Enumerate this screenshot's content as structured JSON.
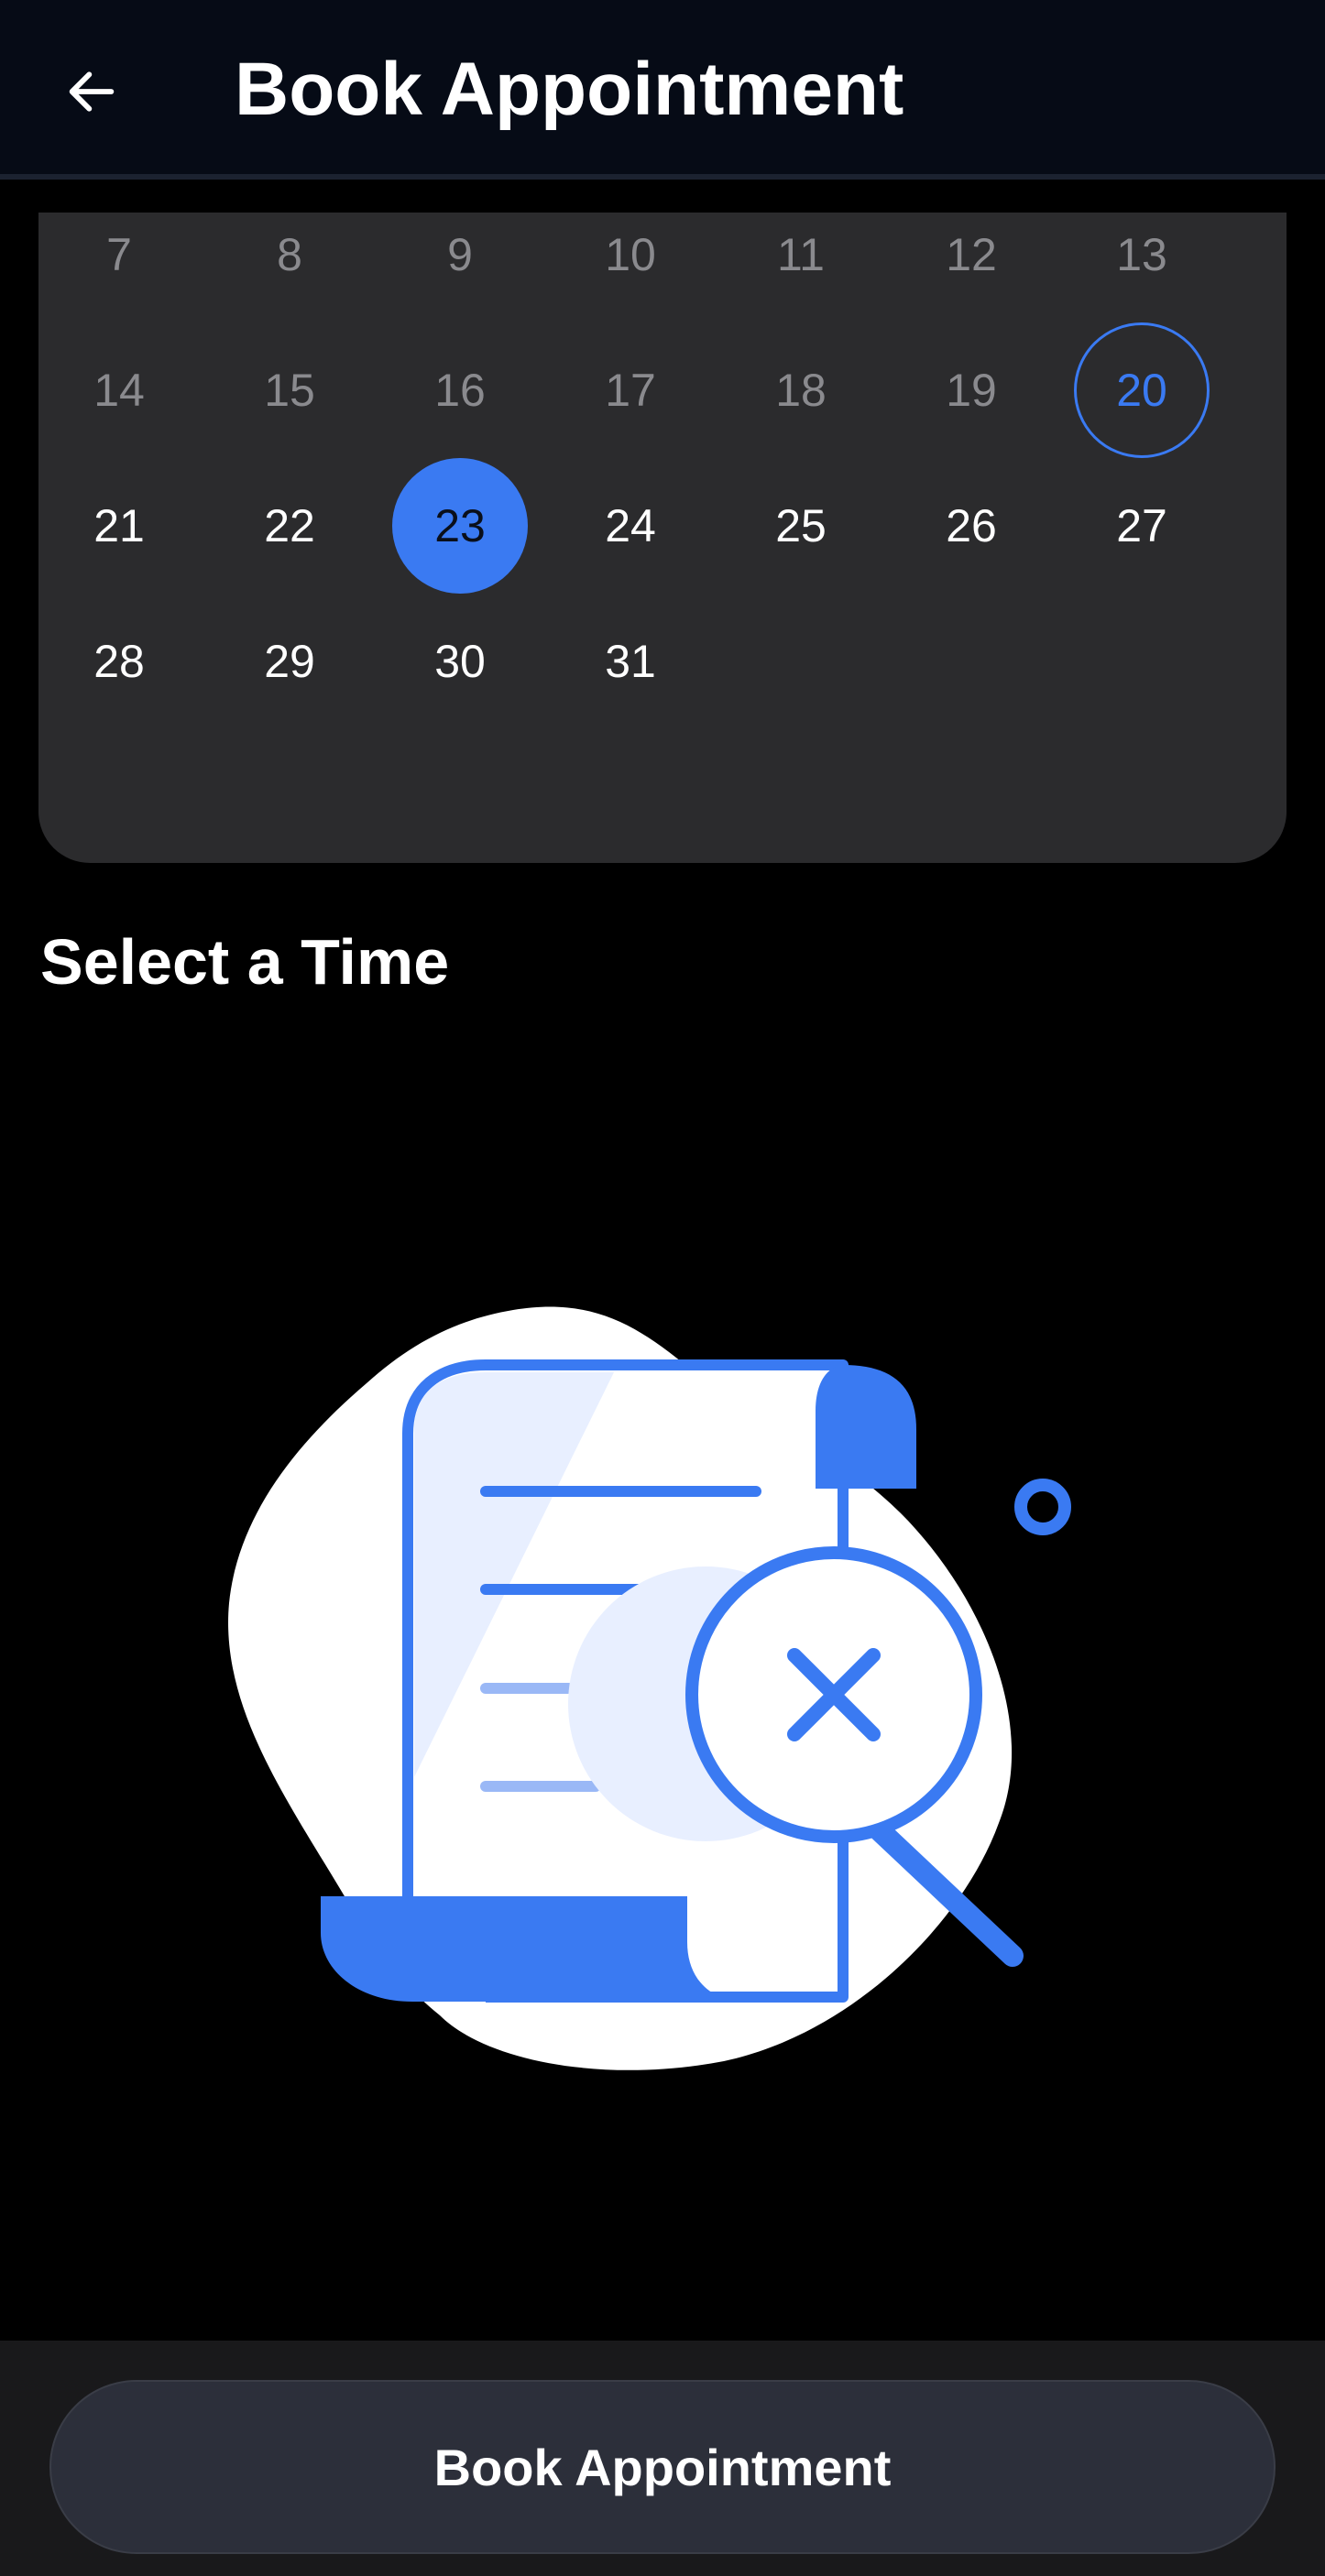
{
  "header": {
    "title": "Book Appointment"
  },
  "calendar": {
    "rows": [
      [
        {
          "day": "7",
          "state": "past"
        },
        {
          "day": "8",
          "state": "past"
        },
        {
          "day": "9",
          "state": "past"
        },
        {
          "day": "10",
          "state": "past"
        },
        {
          "day": "11",
          "state": "past"
        },
        {
          "day": "12",
          "state": "past"
        },
        {
          "day": "13",
          "state": "past"
        }
      ],
      [
        {
          "day": "14",
          "state": "past"
        },
        {
          "day": "15",
          "state": "past"
        },
        {
          "day": "16",
          "state": "past"
        },
        {
          "day": "17",
          "state": "past"
        },
        {
          "day": "18",
          "state": "past"
        },
        {
          "day": "19",
          "state": "past"
        },
        {
          "day": "20",
          "state": "today"
        }
      ],
      [
        {
          "day": "21",
          "state": "available"
        },
        {
          "day": "22",
          "state": "available"
        },
        {
          "day": "23",
          "state": "selected"
        },
        {
          "day": "24",
          "state": "available"
        },
        {
          "day": "25",
          "state": "available"
        },
        {
          "day": "26",
          "state": "available"
        },
        {
          "day": "27",
          "state": "available"
        }
      ],
      [
        {
          "day": "28",
          "state": "available"
        },
        {
          "day": "29",
          "state": "available"
        },
        {
          "day": "30",
          "state": "available"
        },
        {
          "day": "31",
          "state": "available"
        }
      ]
    ]
  },
  "time_section": {
    "title": "Select a Time",
    "empty_state_icon": "document-search-no-results-icon"
  },
  "footer": {
    "book_label": "Book Appointment"
  },
  "colors": {
    "accent": "#3a7af2",
    "background": "#000000",
    "card": "#2b2b2d",
    "header": "#060b16",
    "button": "#2c2f3a"
  }
}
